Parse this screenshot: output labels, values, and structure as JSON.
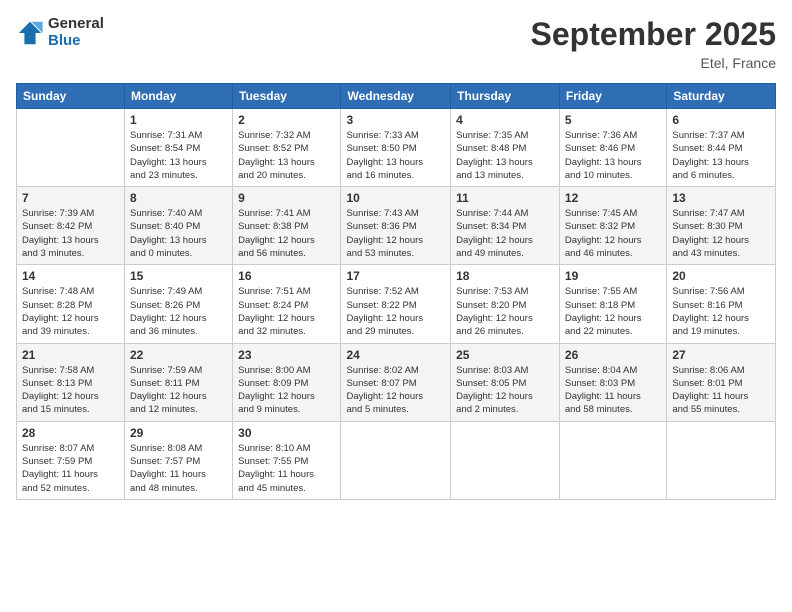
{
  "header": {
    "logo_general": "General",
    "logo_blue": "Blue",
    "month_title": "September 2025",
    "location": "Etel, France"
  },
  "weekdays": [
    "Sunday",
    "Monday",
    "Tuesday",
    "Wednesday",
    "Thursday",
    "Friday",
    "Saturday"
  ],
  "weeks": [
    [
      {
        "day": "",
        "info": ""
      },
      {
        "day": "1",
        "info": "Sunrise: 7:31 AM\nSunset: 8:54 PM\nDaylight: 13 hours\nand 23 minutes."
      },
      {
        "day": "2",
        "info": "Sunrise: 7:32 AM\nSunset: 8:52 PM\nDaylight: 13 hours\nand 20 minutes."
      },
      {
        "day": "3",
        "info": "Sunrise: 7:33 AM\nSunset: 8:50 PM\nDaylight: 13 hours\nand 16 minutes."
      },
      {
        "day": "4",
        "info": "Sunrise: 7:35 AM\nSunset: 8:48 PM\nDaylight: 13 hours\nand 13 minutes."
      },
      {
        "day": "5",
        "info": "Sunrise: 7:36 AM\nSunset: 8:46 PM\nDaylight: 13 hours\nand 10 minutes."
      },
      {
        "day": "6",
        "info": "Sunrise: 7:37 AM\nSunset: 8:44 PM\nDaylight: 13 hours\nand 6 minutes."
      }
    ],
    [
      {
        "day": "7",
        "info": "Sunrise: 7:39 AM\nSunset: 8:42 PM\nDaylight: 13 hours\nand 3 minutes."
      },
      {
        "day": "8",
        "info": "Sunrise: 7:40 AM\nSunset: 8:40 PM\nDaylight: 13 hours\nand 0 minutes."
      },
      {
        "day": "9",
        "info": "Sunrise: 7:41 AM\nSunset: 8:38 PM\nDaylight: 12 hours\nand 56 minutes."
      },
      {
        "day": "10",
        "info": "Sunrise: 7:43 AM\nSunset: 8:36 PM\nDaylight: 12 hours\nand 53 minutes."
      },
      {
        "day": "11",
        "info": "Sunrise: 7:44 AM\nSunset: 8:34 PM\nDaylight: 12 hours\nand 49 minutes."
      },
      {
        "day": "12",
        "info": "Sunrise: 7:45 AM\nSunset: 8:32 PM\nDaylight: 12 hours\nand 46 minutes."
      },
      {
        "day": "13",
        "info": "Sunrise: 7:47 AM\nSunset: 8:30 PM\nDaylight: 12 hours\nand 43 minutes."
      }
    ],
    [
      {
        "day": "14",
        "info": "Sunrise: 7:48 AM\nSunset: 8:28 PM\nDaylight: 12 hours\nand 39 minutes."
      },
      {
        "day": "15",
        "info": "Sunrise: 7:49 AM\nSunset: 8:26 PM\nDaylight: 12 hours\nand 36 minutes."
      },
      {
        "day": "16",
        "info": "Sunrise: 7:51 AM\nSunset: 8:24 PM\nDaylight: 12 hours\nand 32 minutes."
      },
      {
        "day": "17",
        "info": "Sunrise: 7:52 AM\nSunset: 8:22 PM\nDaylight: 12 hours\nand 29 minutes."
      },
      {
        "day": "18",
        "info": "Sunrise: 7:53 AM\nSunset: 8:20 PM\nDaylight: 12 hours\nand 26 minutes."
      },
      {
        "day": "19",
        "info": "Sunrise: 7:55 AM\nSunset: 8:18 PM\nDaylight: 12 hours\nand 22 minutes."
      },
      {
        "day": "20",
        "info": "Sunrise: 7:56 AM\nSunset: 8:16 PM\nDaylight: 12 hours\nand 19 minutes."
      }
    ],
    [
      {
        "day": "21",
        "info": "Sunrise: 7:58 AM\nSunset: 8:13 PM\nDaylight: 12 hours\nand 15 minutes."
      },
      {
        "day": "22",
        "info": "Sunrise: 7:59 AM\nSunset: 8:11 PM\nDaylight: 12 hours\nand 12 minutes."
      },
      {
        "day": "23",
        "info": "Sunrise: 8:00 AM\nSunset: 8:09 PM\nDaylight: 12 hours\nand 9 minutes."
      },
      {
        "day": "24",
        "info": "Sunrise: 8:02 AM\nSunset: 8:07 PM\nDaylight: 12 hours\nand 5 minutes."
      },
      {
        "day": "25",
        "info": "Sunrise: 8:03 AM\nSunset: 8:05 PM\nDaylight: 12 hours\nand 2 minutes."
      },
      {
        "day": "26",
        "info": "Sunrise: 8:04 AM\nSunset: 8:03 PM\nDaylight: 11 hours\nand 58 minutes."
      },
      {
        "day": "27",
        "info": "Sunrise: 8:06 AM\nSunset: 8:01 PM\nDaylight: 11 hours\nand 55 minutes."
      }
    ],
    [
      {
        "day": "28",
        "info": "Sunrise: 8:07 AM\nSunset: 7:59 PM\nDaylight: 11 hours\nand 52 minutes."
      },
      {
        "day": "29",
        "info": "Sunrise: 8:08 AM\nSunset: 7:57 PM\nDaylight: 11 hours\nand 48 minutes."
      },
      {
        "day": "30",
        "info": "Sunrise: 8:10 AM\nSunset: 7:55 PM\nDaylight: 11 hours\nand 45 minutes."
      },
      {
        "day": "",
        "info": ""
      },
      {
        "day": "",
        "info": ""
      },
      {
        "day": "",
        "info": ""
      },
      {
        "day": "",
        "info": ""
      }
    ]
  ]
}
